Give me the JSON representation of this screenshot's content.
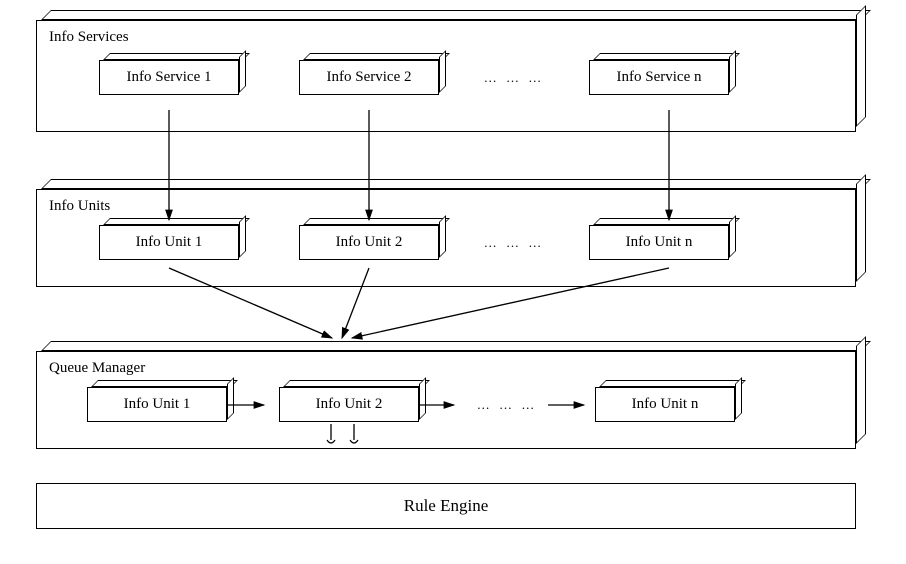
{
  "layers": {
    "services": {
      "title": "Info Services",
      "boxes": [
        "Info Service 1",
        "Info Service 2",
        "Info Service n"
      ],
      "ellipsis": "… … …"
    },
    "units": {
      "title": "Info Units",
      "boxes": [
        "Info Unit 1",
        "Info Unit 2",
        "Info Unit n"
      ],
      "ellipsis": "… … …"
    },
    "queue": {
      "title": "Queue Manager",
      "boxes": [
        "Info Unit 1",
        "Info Unit 2",
        "Info Unit n"
      ],
      "ellipsis": "… … …"
    },
    "engine": {
      "title": "Rule Engine"
    }
  }
}
